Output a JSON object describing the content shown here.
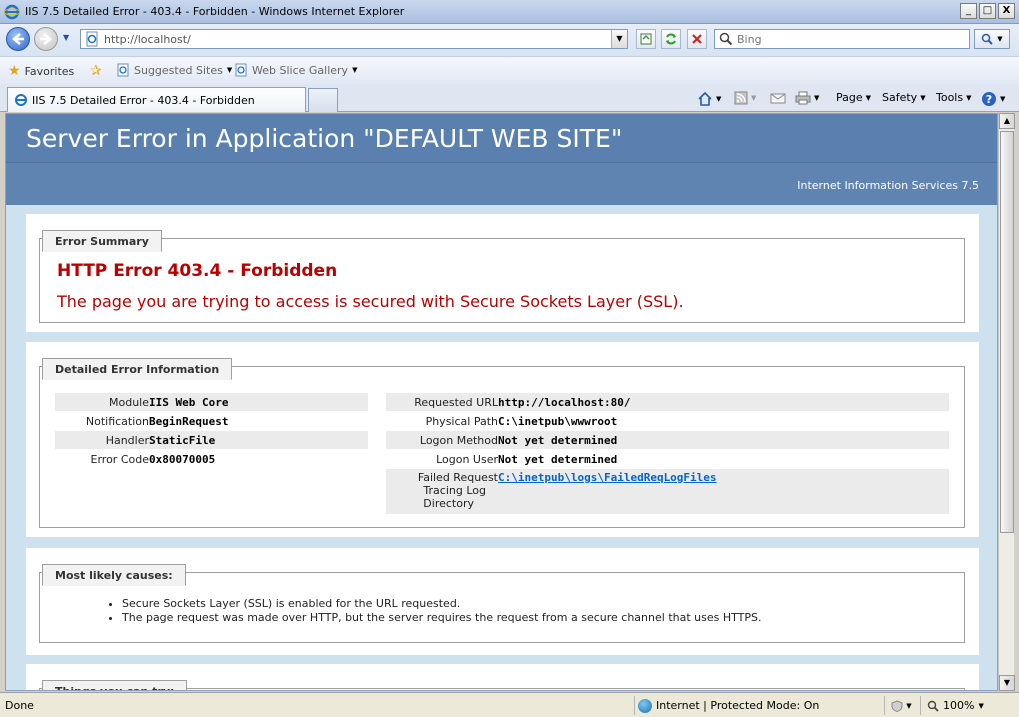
{
  "window": {
    "title": "IIS 7.5 Detailed Error - 403.4 - Forbidden - Windows Internet Explorer",
    "minimize": "_",
    "maximize": "□",
    "close": "X"
  },
  "address_bar": {
    "url": "http://localhost/"
  },
  "search": {
    "placeholder": "Bing"
  },
  "favorites_bar": {
    "favorites": "Favorites",
    "suggested_sites": "Suggested Sites",
    "web_slice_gallery": "Web Slice Gallery"
  },
  "tab": {
    "title": "IIS 7.5 Detailed Error - 403.4 - Forbidden"
  },
  "command_bar": {
    "page": "Page",
    "safety": "Safety",
    "tools": "Tools"
  },
  "page": {
    "header_title": "Server Error in Application \"DEFAULT WEB SITE\"",
    "header_subtitle": "Internet Information Services 7.5",
    "error_summary": {
      "legend": "Error Summary",
      "title": "HTTP Error 403.4 - Forbidden",
      "message": "The page you are trying to access is secured with Secure Sockets Layer (SSL)."
    },
    "detailed_info": {
      "legend": "Detailed Error Information",
      "left": [
        {
          "key": "Module",
          "value": "IIS Web Core"
        },
        {
          "key": "Notification",
          "value": "BeginRequest"
        },
        {
          "key": "Handler",
          "value": "StaticFile"
        },
        {
          "key": "Error Code",
          "value": "0x80070005"
        }
      ],
      "right": [
        {
          "key": "Requested URL",
          "value": "http://localhost:80/"
        },
        {
          "key": "Physical Path",
          "value": "C:\\inetpub\\wwwroot"
        },
        {
          "key": "Logon Method",
          "value": "Not yet determined"
        },
        {
          "key": "Logon User",
          "value": "Not yet determined"
        },
        {
          "key_lines": [
            "Failed Request",
            "Tracing Log",
            "Directory"
          ],
          "value": "C:\\inetpub\\logs\\FailedReqLogFiles"
        }
      ]
    },
    "likely_causes": {
      "legend": "Most likely causes:",
      "items": [
        "Secure Sockets Layer (SSL) is enabled for the URL requested.",
        "The page request was made over HTTP, but the server requires the request from a secure channel that uses HTTPS."
      ]
    },
    "things_to_try": {
      "legend": "Things you can try:"
    }
  },
  "status_bar": {
    "status": "Done",
    "zone": "Internet | Protected Mode: On",
    "zoom": "100%"
  }
}
